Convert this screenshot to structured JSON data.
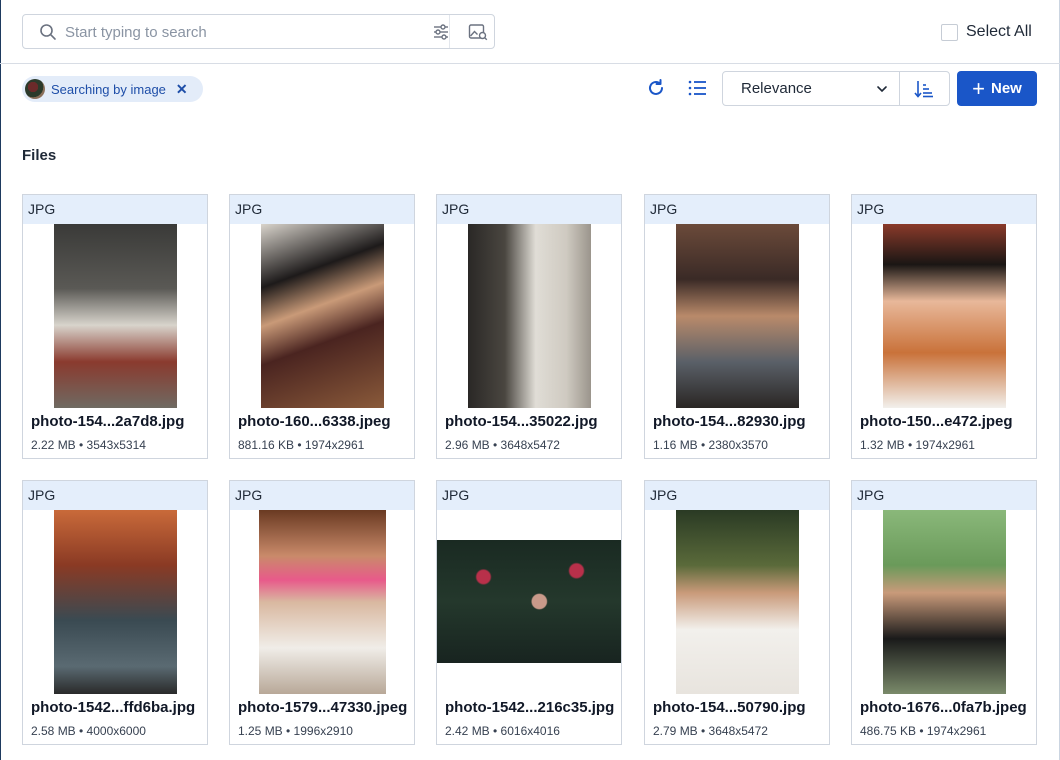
{
  "search": {
    "placeholder": "Start typing to search",
    "value": ""
  },
  "select_all": {
    "label": "Select All"
  },
  "image_chip": {
    "label": "Searching by image",
    "remove_glyph": "✕"
  },
  "toolbar": {
    "sort_value": "Relevance",
    "new_label": "New",
    "new_glyph": "+",
    "colors": {
      "primary": "#1a56c8",
      "chip_bg": "#e3ecf9",
      "card_header_bg": "#e4eefb"
    }
  },
  "section": {
    "title": "Files"
  },
  "files": [
    {
      "type": "JPG",
      "name": "photo-154...2a7d8.jpg",
      "meta": "2.22 MB • 3543x5314"
    },
    {
      "type": "JPG",
      "name": "photo-160...6338.jpeg",
      "meta": "881.16 KB • 1974x2961"
    },
    {
      "type": "JPG",
      "name": "photo-154...35022.jpg",
      "meta": "2.96 MB • 3648x5472"
    },
    {
      "type": "JPG",
      "name": "photo-154...82930.jpg",
      "meta": "1.16 MB • 2380x3570"
    },
    {
      "type": "JPG",
      "name": "photo-150...e472.jpeg",
      "meta": "1.32 MB • 1974x2961"
    },
    {
      "type": "JPG",
      "name": "photo-1542...ffd6ba.jpg",
      "meta": "2.58 MB • 4000x6000"
    },
    {
      "type": "JPG",
      "name": "photo-1579...47330.jpeg",
      "meta": "1.25 MB • 1996x2910"
    },
    {
      "type": "JPG",
      "name": "photo-1542...216c35.jpg",
      "meta": "2.42 MB • 6016x4016"
    },
    {
      "type": "JPG",
      "name": "photo-154...50790.jpg",
      "meta": "2.79 MB • 3648x5472"
    },
    {
      "type": "JPG",
      "name": "photo-1676...0fa7b.jpeg",
      "meta": "486.75 KB • 1974x2961"
    }
  ]
}
